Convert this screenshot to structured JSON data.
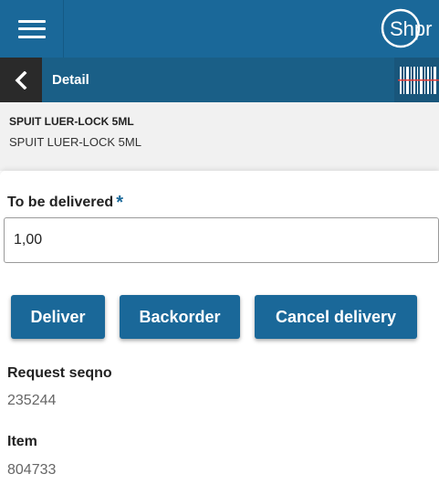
{
  "header": {
    "logo_text": "Shpr",
    "brand_color": "#1a6899"
  },
  "subheader": {
    "title": "Detail",
    "back_icon": "chevron-left-icon",
    "scan_icon": "barcode-icon"
  },
  "product": {
    "code": "SPUIT LUER-LOCK 5ML",
    "description": "SPUIT LUER-LOCK 5ML"
  },
  "form": {
    "qty_label": "To be delivered",
    "required_marker": "*",
    "qty_value": "1,00"
  },
  "actions": {
    "deliver": "Deliver",
    "backorder": "Backorder",
    "cancel": "Cancel delivery"
  },
  "fields": [
    {
      "label": "Request seqno",
      "value": "235244"
    },
    {
      "label": "Item",
      "value": "804733"
    }
  ]
}
